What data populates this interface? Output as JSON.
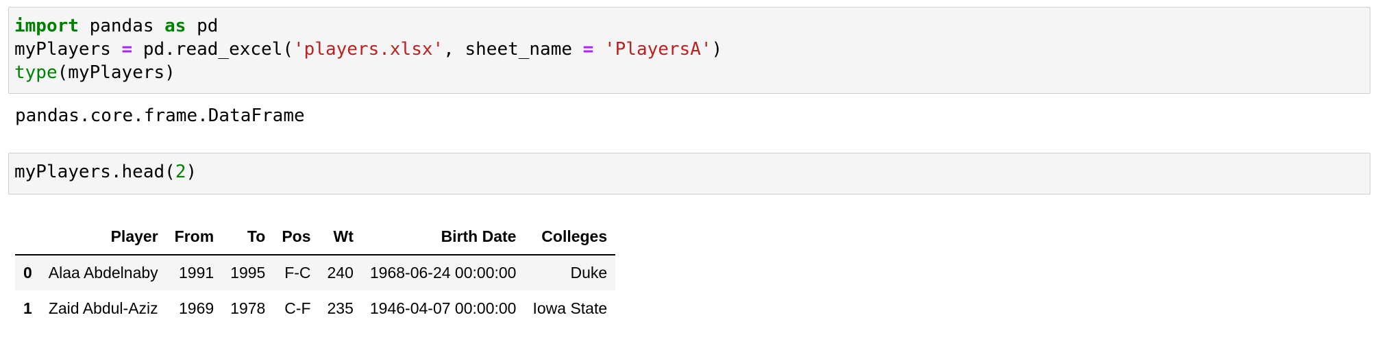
{
  "cell1": {
    "line1": {
      "kw1": "import",
      "t1": " pandas ",
      "kw2": "as",
      "t2": " pd"
    },
    "line2": {
      "t1": "myPlayers ",
      "op1": "=",
      "t2": " pd.read_excel(",
      "s1": "'players.xlsx'",
      "t3": ", sheet_name ",
      "op2": "=",
      "t4": " ",
      "s2": "'PlayersA'",
      "t5": ")"
    },
    "line3": {
      "bi": "type",
      "t1": "(myPlayers)"
    }
  },
  "output1": "pandas.core.frame.DataFrame",
  "cell2": {
    "t1": "myPlayers.head(",
    "num": "2",
    "t2": ")"
  },
  "dataframe": {
    "columns": [
      "",
      "Player",
      "From",
      "To",
      "Pos",
      "Wt",
      "Birth Date",
      "Colleges"
    ],
    "rows": [
      {
        "index": "0",
        "player": "Alaa Abdelnaby",
        "from": "1991",
        "to": "1995",
        "pos": "F-C",
        "wt": "240",
        "birth": "1968-06-24 00:00:00",
        "college": "Duke"
      },
      {
        "index": "1",
        "player": "Zaid Abdul-Aziz",
        "from": "1969",
        "to": "1978",
        "pos": "C-F",
        "wt": "235",
        "birth": "1946-04-07 00:00:00",
        "college": "Iowa State"
      }
    ]
  }
}
